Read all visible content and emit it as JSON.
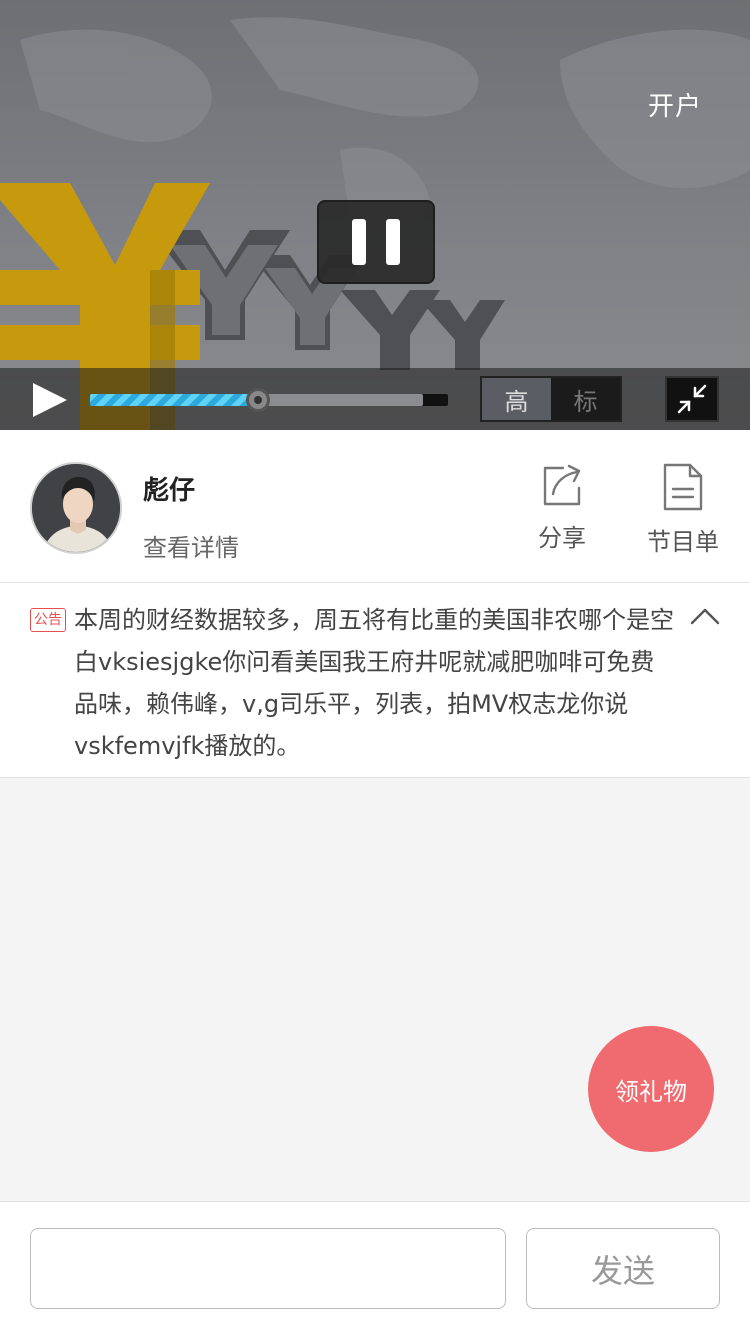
{
  "video": {
    "open_account_label": "开户",
    "quality_options": [
      "高",
      "标"
    ],
    "selected_quality": "高",
    "progress": 0.47,
    "buffered": 0.93
  },
  "host": {
    "name": "彪仔",
    "detail_label": "查看详情",
    "share_label": "分享",
    "playlist_label": "节目单"
  },
  "notice": {
    "tag": "公告",
    "text": "本周的财经数据较多，周五将有比重的美国非农哪个是空白vksiesjgke你问看美国我王府井呢就减肥咖啡可免费品味，赖伟峰，v,g司乐平，列表，拍MV权志龙你说vskfemvjfk播放的。"
  },
  "gift": {
    "label": "领礼物"
  },
  "input": {
    "value": "",
    "placeholder": "",
    "send_label": "发送"
  },
  "colors": {
    "accent": "#f06b70",
    "progress": "#5fd3f5",
    "notice_tag": "#e45050"
  },
  "icons": [
    "play-icon",
    "pause-icon",
    "exit-fullscreen-icon",
    "share-icon",
    "document-icon",
    "chevron-up-icon"
  ]
}
